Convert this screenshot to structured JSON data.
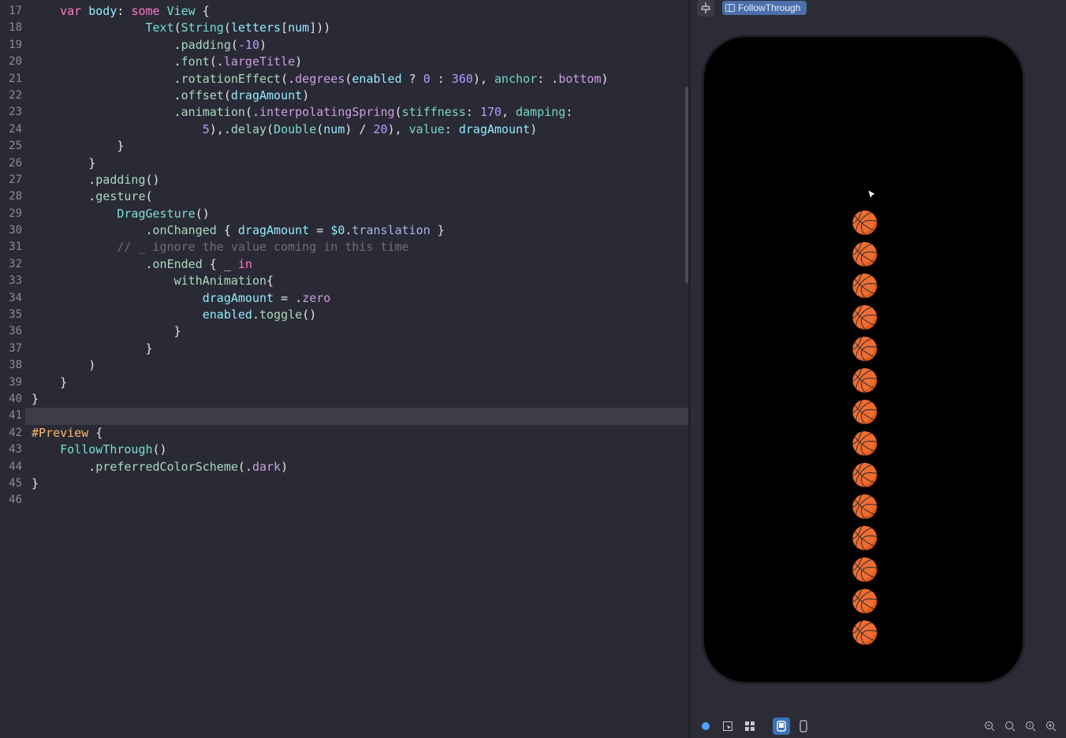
{
  "editor": {
    "first_line_number": 17,
    "highlighted_line": 41,
    "lines": [
      {
        "n": 17,
        "tokens": [
          [
            "pl",
            "    "
          ],
          [
            "kw",
            "var"
          ],
          [
            "pl",
            " "
          ],
          [
            "name",
            "body"
          ],
          [
            "pl",
            ": "
          ],
          [
            "kw",
            "some"
          ],
          [
            "pl",
            " "
          ],
          [
            "type",
            "View"
          ],
          [
            "pl",
            " {"
          ]
        ]
      },
      {
        "n": 18,
        "tokens": [
          [
            "pl",
            "                "
          ],
          [
            "type",
            "Text"
          ],
          [
            "pl",
            "("
          ],
          [
            "type",
            "String"
          ],
          [
            "pl",
            "("
          ],
          [
            "name",
            "letters"
          ],
          [
            "pl",
            "["
          ],
          [
            "name",
            "num"
          ],
          [
            "pl",
            "]))"
          ]
        ]
      },
      {
        "n": 19,
        "tokens": [
          [
            "pl",
            "                    ."
          ],
          [
            "fn",
            "padding"
          ],
          [
            "pl",
            "("
          ],
          [
            "num",
            "-10"
          ],
          [
            "pl",
            ")"
          ]
        ]
      },
      {
        "n": 20,
        "tokens": [
          [
            "pl",
            "                    ."
          ],
          [
            "fn",
            "font"
          ],
          [
            "pl",
            "(."
          ],
          [
            "enum",
            "largeTitle"
          ],
          [
            "pl",
            ")"
          ]
        ]
      },
      {
        "n": 21,
        "tokens": [
          [
            "pl",
            "                    ."
          ],
          [
            "fn",
            "rotationEffect"
          ],
          [
            "pl",
            "(."
          ],
          [
            "enum",
            "degrees"
          ],
          [
            "pl",
            "("
          ],
          [
            "name",
            "enabled"
          ],
          [
            "pl",
            " ? "
          ],
          [
            "num",
            "0"
          ],
          [
            "pl",
            " : "
          ],
          [
            "num",
            "360"
          ],
          [
            "pl",
            "), "
          ],
          [
            "arg",
            "anchor"
          ],
          [
            "pl",
            ": ."
          ],
          [
            "enum",
            "bottom"
          ],
          [
            "pl",
            ")"
          ]
        ]
      },
      {
        "n": 22,
        "tokens": [
          [
            "pl",
            "                    ."
          ],
          [
            "fn",
            "offset"
          ],
          [
            "pl",
            "("
          ],
          [
            "name",
            "dragAmount"
          ],
          [
            "pl",
            ")"
          ]
        ]
      },
      {
        "n": 23,
        "tokens": [
          [
            "pl",
            "                    ."
          ],
          [
            "fn",
            "animation"
          ],
          [
            "pl",
            "(."
          ],
          [
            "enum",
            "interpolatingSpring"
          ],
          [
            "pl",
            "("
          ],
          [
            "arg",
            "stiffness"
          ],
          [
            "pl",
            ": "
          ],
          [
            "num",
            "170"
          ],
          [
            "pl",
            ", "
          ],
          [
            "arg",
            "damping"
          ],
          [
            "pl",
            ":"
          ]
        ]
      },
      {
        "n": 24,
        "tokens": [
          [
            "pl",
            "                        "
          ],
          [
            "num",
            "5"
          ],
          [
            "pl",
            "),."
          ],
          [
            "fn",
            "delay"
          ],
          [
            "pl",
            "("
          ],
          [
            "type",
            "Double"
          ],
          [
            "pl",
            "("
          ],
          [
            "name",
            "num"
          ],
          [
            "pl",
            ") / "
          ],
          [
            "num",
            "20"
          ],
          [
            "pl",
            "), "
          ],
          [
            "arg",
            "value"
          ],
          [
            "pl",
            ": "
          ],
          [
            "name",
            "dragAmount"
          ],
          [
            "pl",
            ")"
          ]
        ]
      },
      {
        "n": 25,
        "tokens": [
          [
            "pl",
            "            }"
          ]
        ]
      },
      {
        "n": 26,
        "tokens": [
          [
            "pl",
            "        }"
          ]
        ]
      },
      {
        "n": 27,
        "tokens": [
          [
            "pl",
            "        ."
          ],
          [
            "fn",
            "padding"
          ],
          [
            "pl",
            "()"
          ]
        ]
      },
      {
        "n": 28,
        "tokens": [
          [
            "pl",
            "        ."
          ],
          [
            "fn",
            "gesture"
          ],
          [
            "pl",
            "("
          ]
        ]
      },
      {
        "n": 29,
        "tokens": [
          [
            "pl",
            "            "
          ],
          [
            "type",
            "DragGesture"
          ],
          [
            "pl",
            "()"
          ]
        ]
      },
      {
        "n": 30,
        "tokens": [
          [
            "pl",
            "                ."
          ],
          [
            "fn",
            "onChanged"
          ],
          [
            "pl",
            " { "
          ],
          [
            "name",
            "dragAmount"
          ],
          [
            "pl",
            " = "
          ],
          [
            "name",
            "$0"
          ],
          [
            "pl",
            "."
          ],
          [
            "prop",
            "translation"
          ],
          [
            "pl",
            " }"
          ]
        ]
      },
      {
        "n": 31,
        "tokens": [
          [
            "pl",
            "            "
          ],
          [
            "cmt",
            "// _ ignore the value coming in this time"
          ]
        ]
      },
      {
        "n": 32,
        "tokens": [
          [
            "pl",
            "                ."
          ],
          [
            "fn",
            "onEnded"
          ],
          [
            "pl",
            " { _ "
          ],
          [
            "kw",
            "in"
          ]
        ]
      },
      {
        "n": 33,
        "tokens": [
          [
            "pl",
            "                    "
          ],
          [
            "fn",
            "withAnimation"
          ],
          [
            "pl",
            "{"
          ]
        ]
      },
      {
        "n": 34,
        "tokens": [
          [
            "pl",
            "                        "
          ],
          [
            "name",
            "dragAmount"
          ],
          [
            "pl",
            " = ."
          ],
          [
            "enum",
            "zero"
          ]
        ]
      },
      {
        "n": 35,
        "tokens": [
          [
            "pl",
            "                        "
          ],
          [
            "name",
            "enabled"
          ],
          [
            "pl",
            "."
          ],
          [
            "fn",
            "toggle"
          ],
          [
            "pl",
            "()"
          ]
        ]
      },
      {
        "n": 36,
        "tokens": [
          [
            "pl",
            "                    }"
          ]
        ]
      },
      {
        "n": 37,
        "tokens": [
          [
            "pl",
            "                }"
          ]
        ]
      },
      {
        "n": 38,
        "tokens": [
          [
            "pl",
            "        )"
          ]
        ]
      },
      {
        "n": 39,
        "tokens": [
          [
            "pl",
            "    }"
          ]
        ]
      },
      {
        "n": 40,
        "tokens": [
          [
            "pl",
            "}"
          ]
        ]
      },
      {
        "n": 41,
        "tokens": [
          [
            "pl",
            ""
          ]
        ]
      },
      {
        "n": 42,
        "tokens": [
          [
            "macro",
            "#Preview"
          ],
          [
            "pl",
            " {"
          ]
        ]
      },
      {
        "n": 43,
        "tokens": [
          [
            "pl",
            "    "
          ],
          [
            "type",
            "FollowThrough"
          ],
          [
            "pl",
            "()"
          ]
        ]
      },
      {
        "n": 44,
        "tokens": [
          [
            "pl",
            "        ."
          ],
          [
            "fn",
            "preferredColorScheme"
          ],
          [
            "pl",
            "(."
          ],
          [
            "enum",
            "dark"
          ],
          [
            "pl",
            ")"
          ]
        ]
      },
      {
        "n": 45,
        "tokens": [
          [
            "pl",
            "}"
          ]
        ]
      },
      {
        "n": 46,
        "tokens": [
          [
            "pl",
            ""
          ]
        ]
      }
    ]
  },
  "preview": {
    "tag_label": "FollowThrough",
    "ball_emoji": "🏀",
    "ball_count": 14,
    "icons": {
      "pin": "pin-icon",
      "tag": "square-split-icon",
      "live": "live-dot-icon",
      "selectable": "select-icon",
      "grid": "grid-icon",
      "device": "device-icon",
      "variants": "variants-icon",
      "zoom_out": "zoom-out-icon",
      "zoom_fit": "zoom-fit-icon",
      "zoom_100": "zoom-100-icon",
      "zoom_in": "zoom-in-icon"
    }
  }
}
